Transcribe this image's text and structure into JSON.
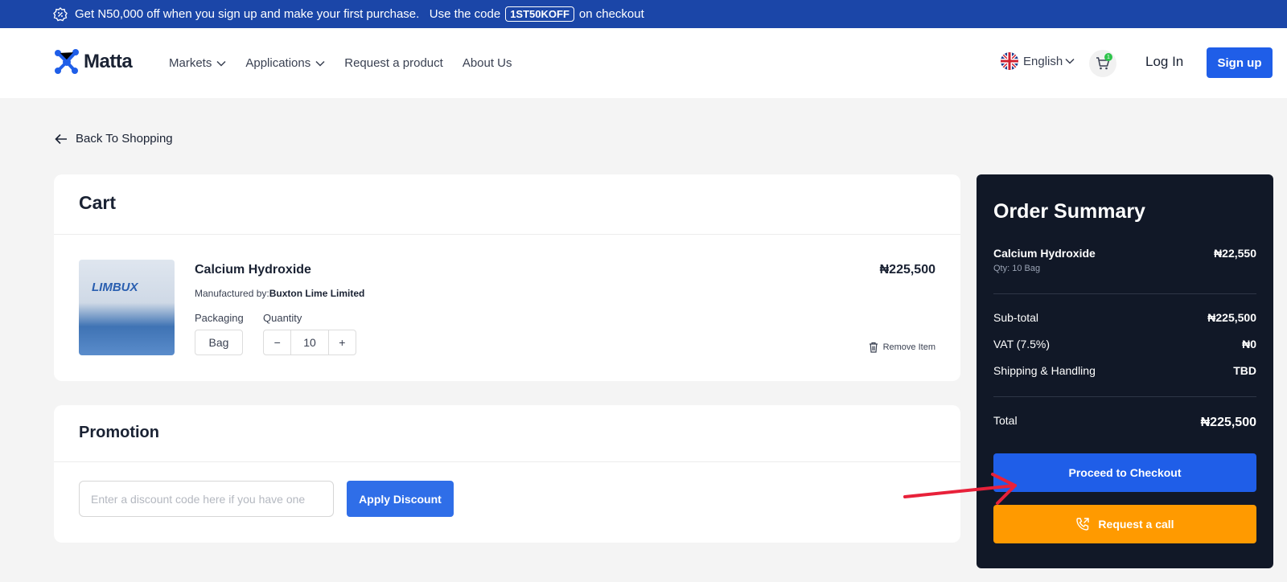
{
  "promo_bar": {
    "text_before": "Get N50,000 off when you sign up and make your first purchase.   Use the code",
    "code": "1ST50KOFF",
    "text_after": "on checkout"
  },
  "nav": {
    "brand": "Matta",
    "menu": [
      {
        "label": "Markets",
        "dropdown": true
      },
      {
        "label": "Applications",
        "dropdown": true
      },
      {
        "label": "Request a product",
        "dropdown": false
      },
      {
        "label": "About Us",
        "dropdown": false
      }
    ],
    "language": "English",
    "cart_count": "1",
    "login": "Log In",
    "signup": "Sign up"
  },
  "back_link": "Back To Shopping",
  "cart": {
    "title": "Cart",
    "item": {
      "image_label": "LIMBUX",
      "name": "Calcium Hydroxide",
      "manufacturer_label": "Manufactured by:",
      "manufacturer": "Buxton Lime Limited",
      "packaging_label": "Packaging",
      "packaging": "Bag",
      "quantity_label": "Quantity",
      "quantity": "10",
      "minus": "−",
      "plus": "+",
      "price": "₦225,500",
      "remove": "Remove Item"
    }
  },
  "promotion": {
    "title": "Promotion",
    "placeholder": "Enter a discount code here if you have one",
    "apply": "Apply Discount"
  },
  "summary": {
    "title": "Order Summary",
    "item_name": "Calcium Hydroxide",
    "item_qty": "Qty: 10 Bag",
    "item_price": "₦22,550",
    "subtotal_label": "Sub-total",
    "subtotal": "₦225,500",
    "vat_label": "VAT (7.5%)",
    "vat": "₦0",
    "shipping_label": "Shipping & Handling",
    "shipping": "TBD",
    "total_label": "Total",
    "total": "₦225,500",
    "checkout": "Proceed to Checkout",
    "call": "Request a call"
  },
  "colors": {
    "primary": "#1f5ee8",
    "promo_bar": "#1b46a8",
    "summary_bg": "#111827",
    "call": "#ff9a00",
    "annotation_arrow": "#e8213a"
  }
}
